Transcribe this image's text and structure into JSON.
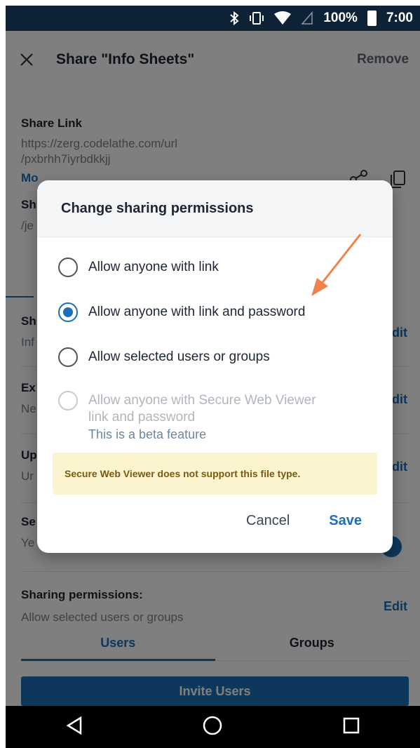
{
  "status_bar": {
    "battery_percent": "100%",
    "time": "7:00",
    "icons": [
      "bluetooth-icon",
      "vibrate-icon",
      "wifi-icon",
      "signal-icon",
      "battery-icon"
    ]
  },
  "header": {
    "title": "Share \"Info Sheets\"",
    "remove_label": "Remove"
  },
  "share_link": {
    "label": "Share Link",
    "url_line1": "https://zerg.codelathe.com/url",
    "url_line2": "/pxbrhh7iyrbdkkjj",
    "modify_label": "Mo",
    "path_label": "Sh",
    "path_value": "/je"
  },
  "rows": [
    {
      "label": "Sh",
      "value": "Inf",
      "edit": "dit"
    },
    {
      "label": "Ex",
      "value": "Ne",
      "edit": "dit"
    },
    {
      "label": "Up",
      "value": "Ur",
      "edit": "dit"
    },
    {
      "label": "Se",
      "value": "Ye"
    }
  ],
  "sharing_permissions": {
    "label": "Sharing permissions:",
    "value": "Allow selected users or groups",
    "edit": "Edit"
  },
  "tabs": [
    {
      "label": "Users",
      "active": true
    },
    {
      "label": "Groups",
      "active": false
    }
  ],
  "invite_label": "Invite Users",
  "dialog": {
    "title": "Change sharing permissions",
    "options": [
      {
        "label": "Allow anyone with link",
        "checked": false,
        "disabled": false
      },
      {
        "label": "Allow anyone with link and password",
        "checked": true,
        "disabled": false
      },
      {
        "label": "Allow selected users or groups",
        "checked": false,
        "disabled": false
      },
      {
        "label_line1": "Allow anyone with Secure Web Viewer",
        "label_line2": "link and password",
        "checked": false,
        "disabled": true
      }
    ],
    "beta_note": "This is a beta feature",
    "warning": "Secure Web Viewer does not support this file type.",
    "cancel_label": "Cancel",
    "save_label": "Save"
  },
  "colors": {
    "accent": "#1d6eb8",
    "status_bar": "#0e2235",
    "annotation_arrow": "#f0834a",
    "warning_bg": "#fcf3cf"
  }
}
